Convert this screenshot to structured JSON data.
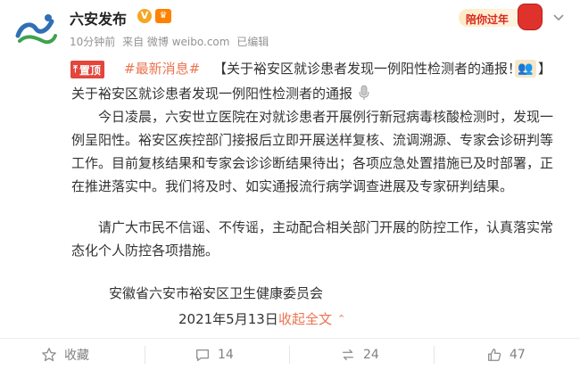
{
  "header": {
    "account_name": "六安发布",
    "meta": {
      "time": "10分钟前",
      "source": "来自 微博 weibo.com",
      "edited": "已编辑"
    },
    "promo_badge": "陪你过年"
  },
  "post": {
    "pin_label": "置顶",
    "hashtag": "#最新消息#",
    "headline": "【关于裕安区就诊患者发现一例阳性检测者的通报！",
    "headline_end": "】",
    "subtitle": "关于裕安区就诊患者发现一例阳性检测者的通报",
    "paragraph1": "今日凌晨，六安世立医院在对就诊患者开展例行新冠病毒核酸检测时，发现一例呈阳性。裕安区疾控部门接报后立即开展送样复核、流调溯源、专家会诊研判等工作。目前复核结果和专家会诊诊断结果待出；各项应急处置措施已及时部署，正在推进落实中。我们将及时、如实通报流行病学调查进展及专家研判结果。",
    "paragraph2": "请广大市民不信谣、不传谣，主动配合相关部门开展的防控工作，认真落实常态化个人防控各项措施。",
    "signature": "安徽省六安市裕安区卫生健康委员会",
    "date": "2021年5月13日",
    "collapse_label": "收起全文"
  },
  "actions": {
    "favorite_label": "收藏",
    "comment_count": "14",
    "repost_count": "24",
    "like_count": "47"
  },
  "colors": {
    "accent": "#eb7350",
    "pin_red": "#e2463c",
    "muted": "#939393"
  },
  "icons": [
    "avatar-logo",
    "verified-icon",
    "vip-icon",
    "more-icon",
    "pin-icon",
    "mic-icon",
    "star-icon",
    "comment-icon",
    "repost-icon",
    "like-icon"
  ]
}
